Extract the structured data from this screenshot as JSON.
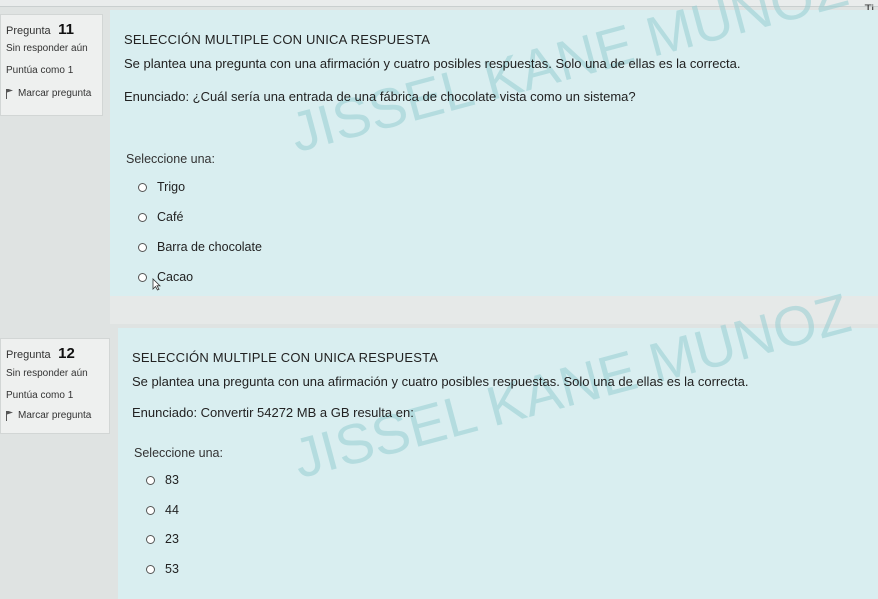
{
  "corner_text": "Ti",
  "questions": [
    {
      "label": "Pregunta",
      "number": "11",
      "status": "Sin responder aún",
      "score": "Puntúa como 1",
      "flag_label": "Marcar pregunta",
      "type": "SELECCIÓN MULTIPLE CON UNICA RESPUESTA",
      "instructions": "Se plantea una pregunta con una afirmación y cuatro posibles respuestas. Solo una de ellas es la correcta.",
      "statement": "Enunciado: ¿Cuál sería una entrada de una fábrica de chocolate vista como un sistema?",
      "prompt": "Seleccione una:",
      "options": [
        "Trigo",
        "Café",
        "Barra de chocolate",
        "Cacao"
      ],
      "watermark": "JISSEL KANE MUNOZ"
    },
    {
      "label": "Pregunta",
      "number": "12",
      "status": "Sin responder aún",
      "score": "Puntúa como 1",
      "flag_label": "Marcar pregunta",
      "type": "SELECCIÓN MULTIPLE CON UNICA RESPUESTA",
      "instructions": "Se plantea una pregunta con una afirmación y cuatro posibles respuestas. Solo una de ellas es la correcta.",
      "statement": "Enunciado: Convertir 54272 MB a GB resulta en:",
      "prompt": "Seleccione una:",
      "options": [
        "83",
        "44",
        "23",
        "53"
      ],
      "watermark": "JISSEL KANE MUNOZ"
    }
  ]
}
